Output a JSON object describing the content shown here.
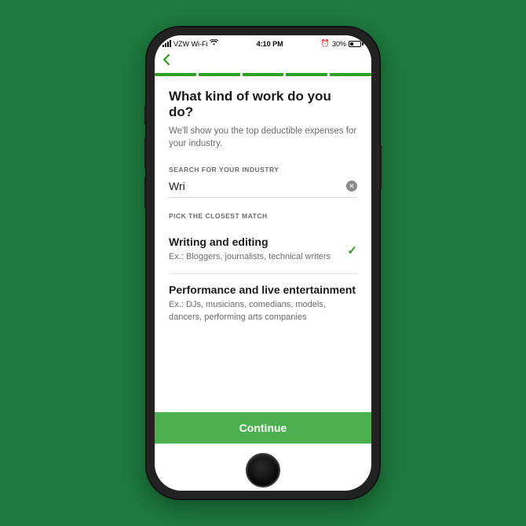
{
  "status": {
    "carrier": "VZW Wi-Fi",
    "time": "4:10 PM",
    "battery": "30%"
  },
  "page": {
    "heading": "What kind of work do you do?",
    "subheading": "We'll show you the top deductible expenses for your industry."
  },
  "search": {
    "label": "SEARCH FOR YOUR INDUSTRY",
    "value": "Wri"
  },
  "results": {
    "label": "PICK THE CLOSEST MATCH",
    "items": [
      {
        "title": "Writing and editing",
        "subtitle": "Ex.: Bloggers, journalists, technical writers",
        "selected": true
      },
      {
        "title": "Performance and live entertainment",
        "subtitle": "Ex.: DJs, musicians, comedians, models, dancers, performing arts companies",
        "selected": false
      }
    ]
  },
  "cta": {
    "label": "Continue"
  },
  "colors": {
    "accent": "#2ca01c",
    "cta": "#4caf50"
  }
}
